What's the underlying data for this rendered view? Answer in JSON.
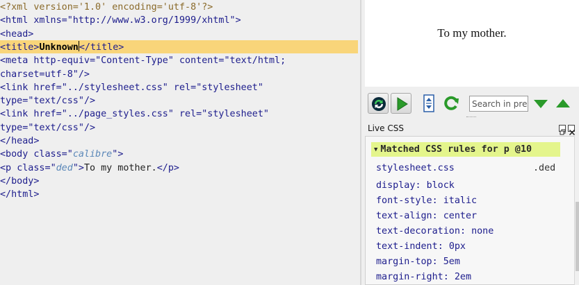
{
  "editor": {
    "lines": [
      {
        "segments": [
          {
            "c": "pi",
            "t": "<?xml version='1.0' encoding='utf-8'?>"
          }
        ]
      },
      {
        "segments": [
          {
            "c": "tag",
            "t": "<html "
          },
          {
            "c": "attr",
            "t": "xmlns="
          },
          {
            "c": "str",
            "t": "\"http://www.w3.org/1999/xhtml\""
          },
          {
            "c": "tag",
            "t": ">"
          }
        ]
      },
      {
        "segments": [
          {
            "c": "tag",
            "t": "<head>"
          }
        ]
      },
      {
        "segments": [
          {
            "c": "tag",
            "t": "<title>"
          },
          {
            "c": "bold",
            "t": "Unknown"
          },
          {
            "c": "caret",
            "t": ""
          },
          {
            "c": "tag",
            "t": "</title>"
          }
        ],
        "highlight": true
      },
      {
        "segments": [
          {
            "c": "tag",
            "t": "<meta "
          },
          {
            "c": "attr",
            "t": "http-equiv="
          },
          {
            "c": "str",
            "t": "\"Content-Type\""
          },
          {
            "c": "attr",
            "t": " content="
          },
          {
            "c": "str",
            "t": "\"text/html;"
          }
        ]
      },
      {
        "segments": [
          {
            "c": "str",
            "t": "charset=utf-8\""
          },
          {
            "c": "tag",
            "t": "/>"
          }
        ]
      },
      {
        "segments": [
          {
            "c": "tag",
            "t": "<link "
          },
          {
            "c": "attr",
            "t": "href="
          },
          {
            "c": "str",
            "t": "\"../stylesheet.css\""
          },
          {
            "c": "attr",
            "t": " rel="
          },
          {
            "c": "str",
            "t": "\"stylesheet\""
          }
        ]
      },
      {
        "segments": [
          {
            "c": "attr",
            "t": "type="
          },
          {
            "c": "str",
            "t": "\"text/css\""
          },
          {
            "c": "tag",
            "t": "/>"
          }
        ]
      },
      {
        "segments": [
          {
            "c": "tag",
            "t": "<link "
          },
          {
            "c": "attr",
            "t": "href="
          },
          {
            "c": "str",
            "t": "\"../page_styles.css\""
          },
          {
            "c": "attr",
            "t": " rel="
          },
          {
            "c": "str",
            "t": "\"stylesheet\""
          }
        ]
      },
      {
        "segments": [
          {
            "c": "attr",
            "t": "type="
          },
          {
            "c": "str",
            "t": "\"text/css\""
          },
          {
            "c": "tag",
            "t": "/>"
          }
        ]
      },
      {
        "segments": [
          {
            "c": "tag",
            "t": "</head>"
          }
        ]
      },
      {
        "segments": [
          {
            "c": "tag",
            "t": "<body "
          },
          {
            "c": "attr",
            "t": "class="
          },
          {
            "c": "str",
            "t": "\""
          },
          {
            "c": "cls",
            "t": "calibre"
          },
          {
            "c": "str",
            "t": "\""
          },
          {
            "c": "tag",
            "t": ">"
          }
        ]
      },
      {
        "segments": [
          {
            "c": "tag",
            "t": "<p "
          },
          {
            "c": "attr",
            "t": "class="
          },
          {
            "c": "str",
            "t": "\""
          },
          {
            "c": "cls",
            "t": "ded"
          },
          {
            "c": "str",
            "t": "\""
          },
          {
            "c": "tag",
            "t": ">"
          },
          {
            "c": "plain",
            "t": "To my mother."
          },
          {
            "c": "tag",
            "t": "</p>"
          }
        ]
      },
      {
        "segments": [
          {
            "c": "tag",
            "t": "</body>"
          }
        ]
      },
      {
        "segments": [
          {
            "c": "tag",
            "t": "</html>"
          }
        ]
      }
    ]
  },
  "preview": {
    "text": "To my mother."
  },
  "toolbar": {
    "search_placeholder": "Search in pre...",
    "icons": [
      "sync-icon",
      "play-icon",
      "document-arrows-icon",
      "refresh-icon",
      "arrow-down-icon",
      "arrow-up-icon"
    ],
    "colors": {
      "green": "#2a9a2a",
      "blue": "#2a5fa8"
    }
  },
  "live_css": {
    "panel_title": "Live CSS",
    "rules_header": "Matched CSS rules for p @10",
    "stylesheet": "stylesheet.css",
    "selector": ".ded",
    "properties": [
      {
        "name": "display",
        "value": "block"
      },
      {
        "name": "font-style",
        "value": "italic"
      },
      {
        "name": "text-align",
        "value": "center"
      },
      {
        "name": "text-decoration",
        "value": "none"
      },
      {
        "name": "text-indent",
        "value": "0px"
      },
      {
        "name": "margin-top",
        "value": "5em"
      },
      {
        "name": "margin-right",
        "value": "2em"
      }
    ]
  }
}
